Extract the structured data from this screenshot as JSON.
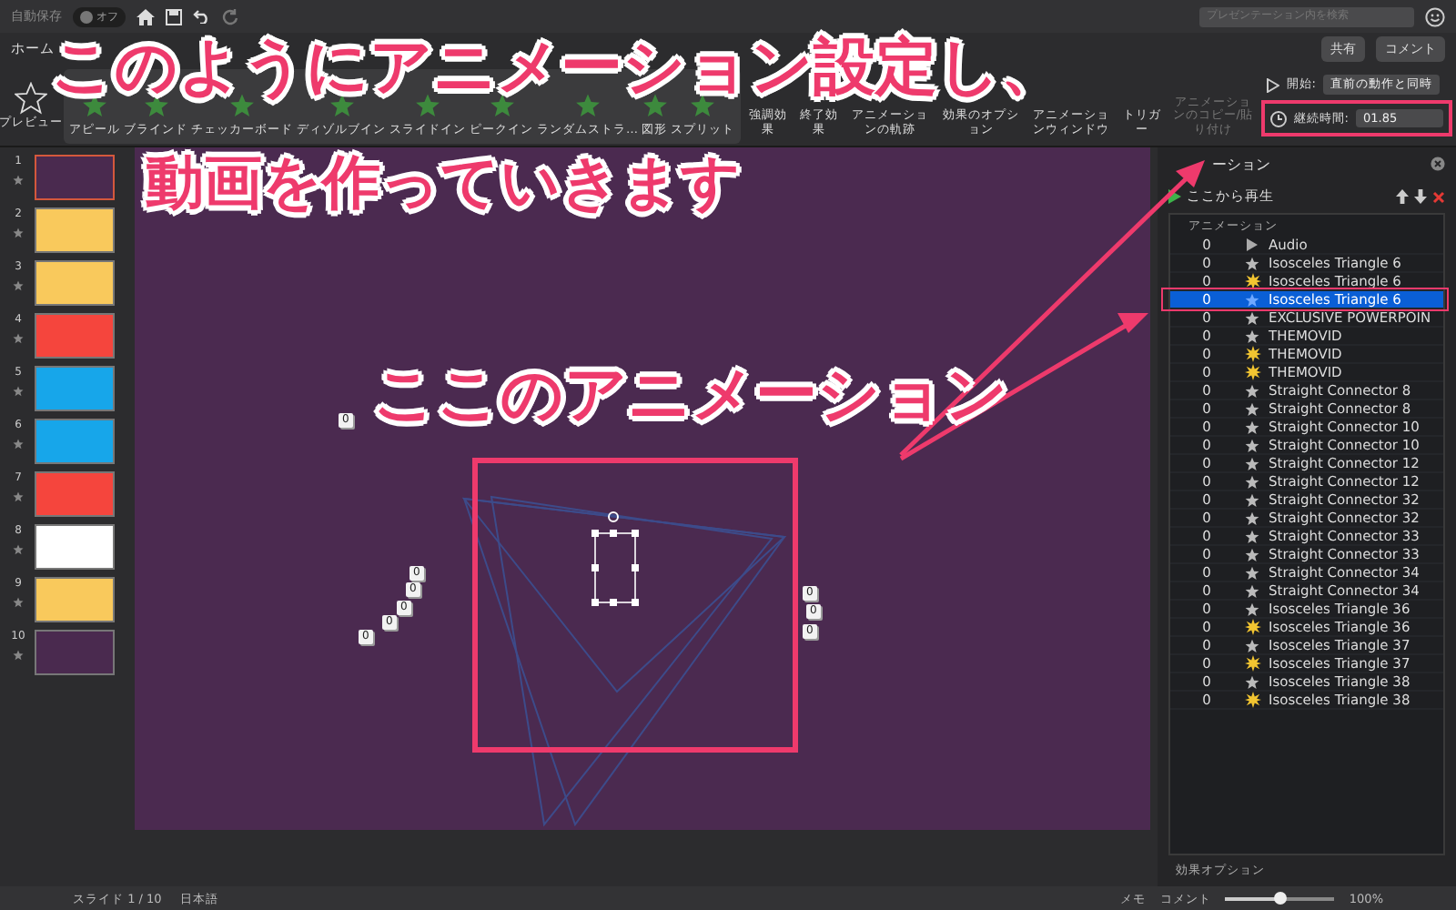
{
  "title_bar": {
    "autosave_label": "自動保存",
    "autosave_toggle": {
      "on": false,
      "label": "オフ"
    },
    "search": {
      "placeholder": "プレゼンテーション内を検索"
    }
  },
  "ribbon_tabs": [
    {
      "label": "ホーム",
      "selected": false
    }
  ],
  "share_button": "共有",
  "comment_button": "コメント",
  "ribbon": {
    "preview": "プレビュー",
    "effects": [
      "アピール",
      "ブラインド",
      "チェッカーボード",
      "ディゾルブイン",
      "スライドイン",
      "ピークイン",
      "ランダムストラ…",
      "図形",
      "スプリット"
    ],
    "tools": [
      {
        "label": "強調効果",
        "disabled": false
      },
      {
        "label": "終了効果",
        "disabled": false
      },
      {
        "label": "アニメーションの軌跡",
        "disabled": false
      },
      {
        "label": "効果のオプション",
        "disabled": false
      },
      {
        "label": "アニメーションウィンドウ",
        "disabled": false
      },
      {
        "label": "トリガー",
        "disabled": false
      },
      {
        "label": "アニメーションのコピー/貼り付け",
        "disabled": true
      }
    ],
    "start": {
      "label": "開始:",
      "value": "直前の動作と同時"
    },
    "duration": {
      "label": "継続時間:",
      "value": "01.85"
    }
  },
  "slides": [
    {
      "number": "1",
      "color": "#4a2a4f",
      "selected": true
    },
    {
      "number": "2",
      "color": "#f9c95c",
      "selected": false
    },
    {
      "number": "3",
      "color": "#f9c95c",
      "selected": false
    },
    {
      "number": "4",
      "color": "#f5453d",
      "selected": false
    },
    {
      "number": "5",
      "color": "#17a6ea",
      "selected": false
    },
    {
      "number": "6",
      "color": "#17a6ea",
      "selected": false
    },
    {
      "number": "7",
      "color": "#f5453d",
      "selected": false
    },
    {
      "number": "8",
      "color": "#ffffff",
      "selected": false
    },
    {
      "number": "9",
      "color": "#f9c95c",
      "selected": false
    },
    {
      "number": "10",
      "color": "#4a2a4f",
      "selected": false
    }
  ],
  "canvas": {
    "tags": [
      "0",
      "0",
      "0",
      "0",
      "0",
      "0",
      "0",
      "0",
      "0"
    ]
  },
  "animation_pane": {
    "title": "ーション",
    "play_from": "ここから再生",
    "column": "アニメーション",
    "rows": [
      {
        "order": "0",
        "kind": "audio",
        "name": "Audio",
        "selected": false
      },
      {
        "order": "0",
        "kind": "star",
        "name": "Isosceles Triangle 6",
        "selected": false
      },
      {
        "order": "0",
        "kind": "burst",
        "name": "Isosceles Triangle 6",
        "selected": false
      },
      {
        "order": "0",
        "kind": "star",
        "name": "Isosceles Triangle 6",
        "selected": true
      },
      {
        "order": "0",
        "kind": "star",
        "name": "EXCLUSIVE POWERPOIN",
        "selected": false
      },
      {
        "order": "0",
        "kind": "star",
        "name": "THEMOVID",
        "selected": false
      },
      {
        "order": "0",
        "kind": "burst",
        "name": "THEMOVID",
        "selected": false
      },
      {
        "order": "0",
        "kind": "burst",
        "name": "THEMOVID",
        "selected": false
      },
      {
        "order": "0",
        "kind": "star",
        "name": "Straight Connector 8",
        "selected": false
      },
      {
        "order": "0",
        "kind": "star",
        "name": "Straight Connector 8",
        "selected": false
      },
      {
        "order": "0",
        "kind": "star",
        "name": "Straight Connector 10",
        "selected": false
      },
      {
        "order": "0",
        "kind": "star",
        "name": "Straight Connector 10",
        "selected": false
      },
      {
        "order": "0",
        "kind": "star",
        "name": "Straight Connector 12",
        "selected": false
      },
      {
        "order": "0",
        "kind": "star",
        "name": "Straight Connector 12",
        "selected": false
      },
      {
        "order": "0",
        "kind": "star",
        "name": "Straight Connector 32",
        "selected": false
      },
      {
        "order": "0",
        "kind": "star",
        "name": "Straight Connector 32",
        "selected": false
      },
      {
        "order": "0",
        "kind": "star",
        "name": "Straight Connector 33",
        "selected": false
      },
      {
        "order": "0",
        "kind": "star",
        "name": "Straight Connector 33",
        "selected": false
      },
      {
        "order": "0",
        "kind": "star",
        "name": "Straight Connector 34",
        "selected": false
      },
      {
        "order": "0",
        "kind": "star",
        "name": "Straight Connector 34",
        "selected": false
      },
      {
        "order": "0",
        "kind": "star",
        "name": "Isosceles Triangle 36",
        "selected": false
      },
      {
        "order": "0",
        "kind": "burst",
        "name": "Isosceles Triangle 36",
        "selected": false
      },
      {
        "order": "0",
        "kind": "star",
        "name": "Isosceles Triangle 37",
        "selected": false
      },
      {
        "order": "0",
        "kind": "burst",
        "name": "Isosceles Triangle 37",
        "selected": false
      },
      {
        "order": "0",
        "kind": "star",
        "name": "Isosceles Triangle 38",
        "selected": false
      },
      {
        "order": "0",
        "kind": "burst",
        "name": "Isosceles Triangle 38",
        "selected": false
      }
    ],
    "effect_options": "効果オプション"
  },
  "status_bar": {
    "slide": "スライド 1 / 10",
    "language": "日本語",
    "notes": "メモ",
    "comments": "コメント",
    "zoom": {
      "level": 0.5,
      "reading": "100%"
    }
  },
  "annotations": [
    "このようにアニメーション設定し、",
    "動画を作っていきます",
    "ここのアニメーション"
  ]
}
